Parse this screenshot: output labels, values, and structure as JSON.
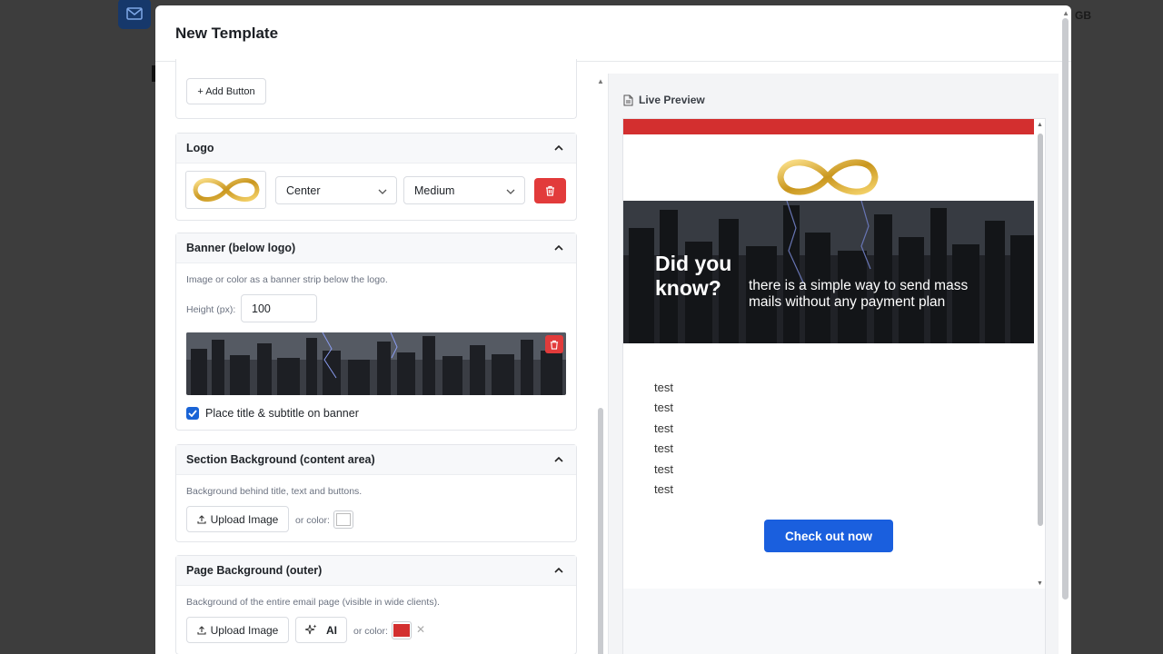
{
  "backdrop": {
    "lang_badge": "GB"
  },
  "modal": {
    "title": "New Template"
  },
  "buttons_card": {
    "add_button_label": "+ Add Button"
  },
  "logo_card": {
    "title": "Logo",
    "alignment": "Center",
    "size": "Medium"
  },
  "banner_card": {
    "title": "Banner (below logo)",
    "hint": "Image or color as a banner strip below the logo.",
    "height_label": "Height (px):",
    "height_value": "100",
    "place_title_label": "Place title & subtitle on banner",
    "place_title_checked": true
  },
  "section_bg_card": {
    "title": "Section Background (content area)",
    "hint": "Background behind title, text and buttons.",
    "upload_label": "Upload Image",
    "or_color_label": "or color:",
    "color": "#ffffff"
  },
  "page_bg_card": {
    "title": "Page Background (outer)",
    "hint": "Background of the entire email page (visible in wide clients).",
    "upload_label": "Upload Image",
    "ai_label": "AI",
    "or_color_label": "or color:",
    "color": "#d32f2f"
  },
  "preview": {
    "label": "Live Preview",
    "banner_title": "Did you know?",
    "banner_subtitle": "there is a simple way to send mass mails without any payment plan",
    "body_lines": [
      "test",
      "test",
      "test",
      "test",
      "test",
      "test"
    ],
    "cta_label": "Check out now",
    "accent_color": "#d32f2f",
    "cta_color": "#1a5fde"
  }
}
